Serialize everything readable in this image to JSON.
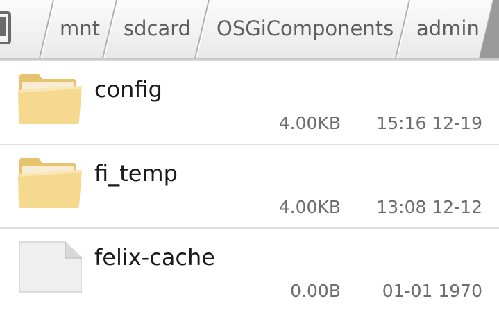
{
  "breadcrumb": {
    "root_icon": "phone-device-icon",
    "items": [
      {
        "label": "mnt"
      },
      {
        "label": "sdcard"
      },
      {
        "label": "OSGiComponents"
      },
      {
        "label": "admin"
      }
    ]
  },
  "files": [
    {
      "name": "config",
      "type": "folder",
      "icon": "folder-icon",
      "size": "4.00KB",
      "date": "15:16 12-19"
    },
    {
      "name": "fi_temp",
      "type": "folder",
      "icon": "folder-icon",
      "size": "4.00KB",
      "date": "13:08 12-12"
    },
    {
      "name": "felix-cache",
      "type": "file",
      "icon": "file-icon",
      "size": "0.00B",
      "date": "01-01 1970"
    }
  ],
  "colors": {
    "folder_fill": "#f3d78e",
    "folder_back": "#e8c676",
    "file_fill": "#eeeeee",
    "text_primary": "#1a1a1a",
    "text_secondary": "#6e6e6e",
    "divider": "#e0e0e0"
  }
}
